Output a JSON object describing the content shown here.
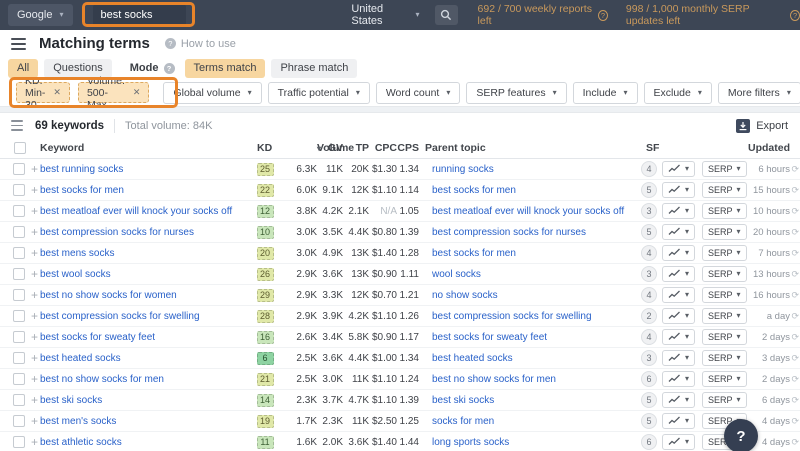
{
  "topbar": {
    "engine_label": "Google",
    "query_value": "best socks",
    "country_label": "United States",
    "weekly_reports_label": "692 / 700 weekly reports left",
    "serp_updates_label": "998 / 1,000 monthly SERP updates left"
  },
  "report": {
    "title": "Matching terms",
    "help_label": "How to use"
  },
  "tabs": {
    "all": "All",
    "questions": "Questions",
    "mode_label": "Mode",
    "terms_match": "Terms match",
    "phrase_match": "Phrase match"
  },
  "filters": {
    "chips": [
      {
        "label": "KD: Min-30"
      },
      {
        "label": "Volume: 500-Max"
      }
    ],
    "buttons": [
      "Global volume",
      "Traffic potential",
      "Word count",
      "SERP features",
      "Include",
      "Exclude",
      "More filters"
    ]
  },
  "toolbar": {
    "keywords_count": "69 keywords",
    "total_volume": "Total volume: 84K",
    "export_label": "Export"
  },
  "table": {
    "headers": {
      "keyword": "Keyword",
      "kd": "KD",
      "volume": "Volume",
      "gv": "GV",
      "tp": "TP",
      "cpc": "CPC",
      "cps": "CPS",
      "parent": "Parent topic",
      "sf": "SF",
      "updated": "Updated"
    },
    "serp_button_label": "SERP",
    "rows": [
      {
        "keyword": "best running socks",
        "kd": "25",
        "kd_level": "mid",
        "volume": "6.3K",
        "gv": "11K",
        "tp": "20K",
        "cpc": "$1.30",
        "cps": "1.34",
        "parent": "running socks",
        "sf": "4",
        "updated": "6 hours"
      },
      {
        "keyword": "best socks for men",
        "kd": "22",
        "kd_level": "mid",
        "volume": "6.0K",
        "gv": "9.1K",
        "tp": "12K",
        "cpc": "$1.10",
        "cps": "1.14",
        "parent": "best socks for men",
        "sf": "5",
        "updated": "15 hours"
      },
      {
        "keyword": "best meatloaf ever will knock your socks off",
        "kd": "12",
        "kd_level": "low",
        "volume": "3.8K",
        "gv": "4.2K",
        "tp": "2.1K",
        "cpc": "N/A",
        "cps": "1.05",
        "parent": "best meatloaf ever will knock your socks off",
        "sf": "3",
        "updated": "10 hours"
      },
      {
        "keyword": "best compression socks for nurses",
        "kd": "10",
        "kd_level": "low",
        "volume": "3.0K",
        "gv": "3.5K",
        "tp": "4.4K",
        "cpc": "$0.80",
        "cps": "1.39",
        "parent": "best compression socks for nurses",
        "sf": "5",
        "updated": "20 hours"
      },
      {
        "keyword": "best mens socks",
        "kd": "20",
        "kd_level": "mid",
        "volume": "3.0K",
        "gv": "4.9K",
        "tp": "13K",
        "cpc": "$1.40",
        "cps": "1.28",
        "parent": "best socks for men",
        "sf": "4",
        "updated": "7 hours"
      },
      {
        "keyword": "best wool socks",
        "kd": "26",
        "kd_level": "mid",
        "volume": "2.9K",
        "gv": "3.6K",
        "tp": "13K",
        "cpc": "$0.90",
        "cps": "1.11",
        "parent": "wool socks",
        "sf": "3",
        "updated": "13 hours"
      },
      {
        "keyword": "best no show socks for women",
        "kd": "29",
        "kd_level": "mid",
        "volume": "2.9K",
        "gv": "3.3K",
        "tp": "12K",
        "cpc": "$0.70",
        "cps": "1.21",
        "parent": "no show socks",
        "sf": "4",
        "updated": "16 hours"
      },
      {
        "keyword": "best compression socks for swelling",
        "kd": "28",
        "kd_level": "mid",
        "volume": "2.9K",
        "gv": "3.9K",
        "tp": "4.2K",
        "cpc": "$1.10",
        "cps": "1.26",
        "parent": "best compression socks for swelling",
        "sf": "2",
        "updated": "a day"
      },
      {
        "keyword": "best socks for sweaty feet",
        "kd": "16",
        "kd_level": "low",
        "volume": "2.6K",
        "gv": "3.4K",
        "tp": "5.8K",
        "cpc": "$0.90",
        "cps": "1.17",
        "parent": "best socks for sweaty feet",
        "sf": "4",
        "updated": "2 days"
      },
      {
        "keyword": "best heated socks",
        "kd": "6",
        "kd_level": "lowest",
        "volume": "2.5K",
        "gv": "3.6K",
        "tp": "4.4K",
        "cpc": "$1.00",
        "cps": "1.34",
        "parent": "best heated socks",
        "sf": "3",
        "updated": "3 days"
      },
      {
        "keyword": "best no show socks for men",
        "kd": "21",
        "kd_level": "mid",
        "volume": "2.5K",
        "gv": "3.0K",
        "tp": "11K",
        "cpc": "$1.10",
        "cps": "1.24",
        "parent": "best no show socks for men",
        "sf": "6",
        "updated": "2 days"
      },
      {
        "keyword": "best ski socks",
        "kd": "14",
        "kd_level": "low",
        "volume": "2.3K",
        "gv": "3.7K",
        "tp": "4.7K",
        "cpc": "$1.10",
        "cps": "1.39",
        "parent": "best ski socks",
        "sf": "5",
        "updated": "6 days"
      },
      {
        "keyword": "best men's socks",
        "kd": "19",
        "kd_level": "mid",
        "volume": "1.7K",
        "gv": "2.3K",
        "tp": "11K",
        "cpc": "$2.50",
        "cps": "1.25",
        "parent": "socks for men",
        "sf": "5",
        "updated": "4 days"
      },
      {
        "keyword": "best athletic socks",
        "kd": "11",
        "kd_level": "low",
        "volume": "1.6K",
        "gv": "2.0K",
        "tp": "3.6K",
        "cpc": "$1.40",
        "cps": "1.44",
        "parent": "long sports socks",
        "sf": "6",
        "updated": "4 days"
      }
    ]
  },
  "icons": {
    "caret": "▾",
    "close": "✕",
    "plus": "+",
    "refresh": "⟳",
    "question": "?"
  },
  "colors": {
    "annotation_orange": "#e8842a",
    "topbar_bg": "#3d4655",
    "link_blue": "#2961c9",
    "tab_selected_bg": "#f7d6a0",
    "chip_bg": "#fbe3bd",
    "kd_mid": "#e0e8a8",
    "kd_low": "#c9e6bb",
    "kd_lowest": "#8ed3a2",
    "usage_text": "#c9995c"
  },
  "help_bubble": "?"
}
